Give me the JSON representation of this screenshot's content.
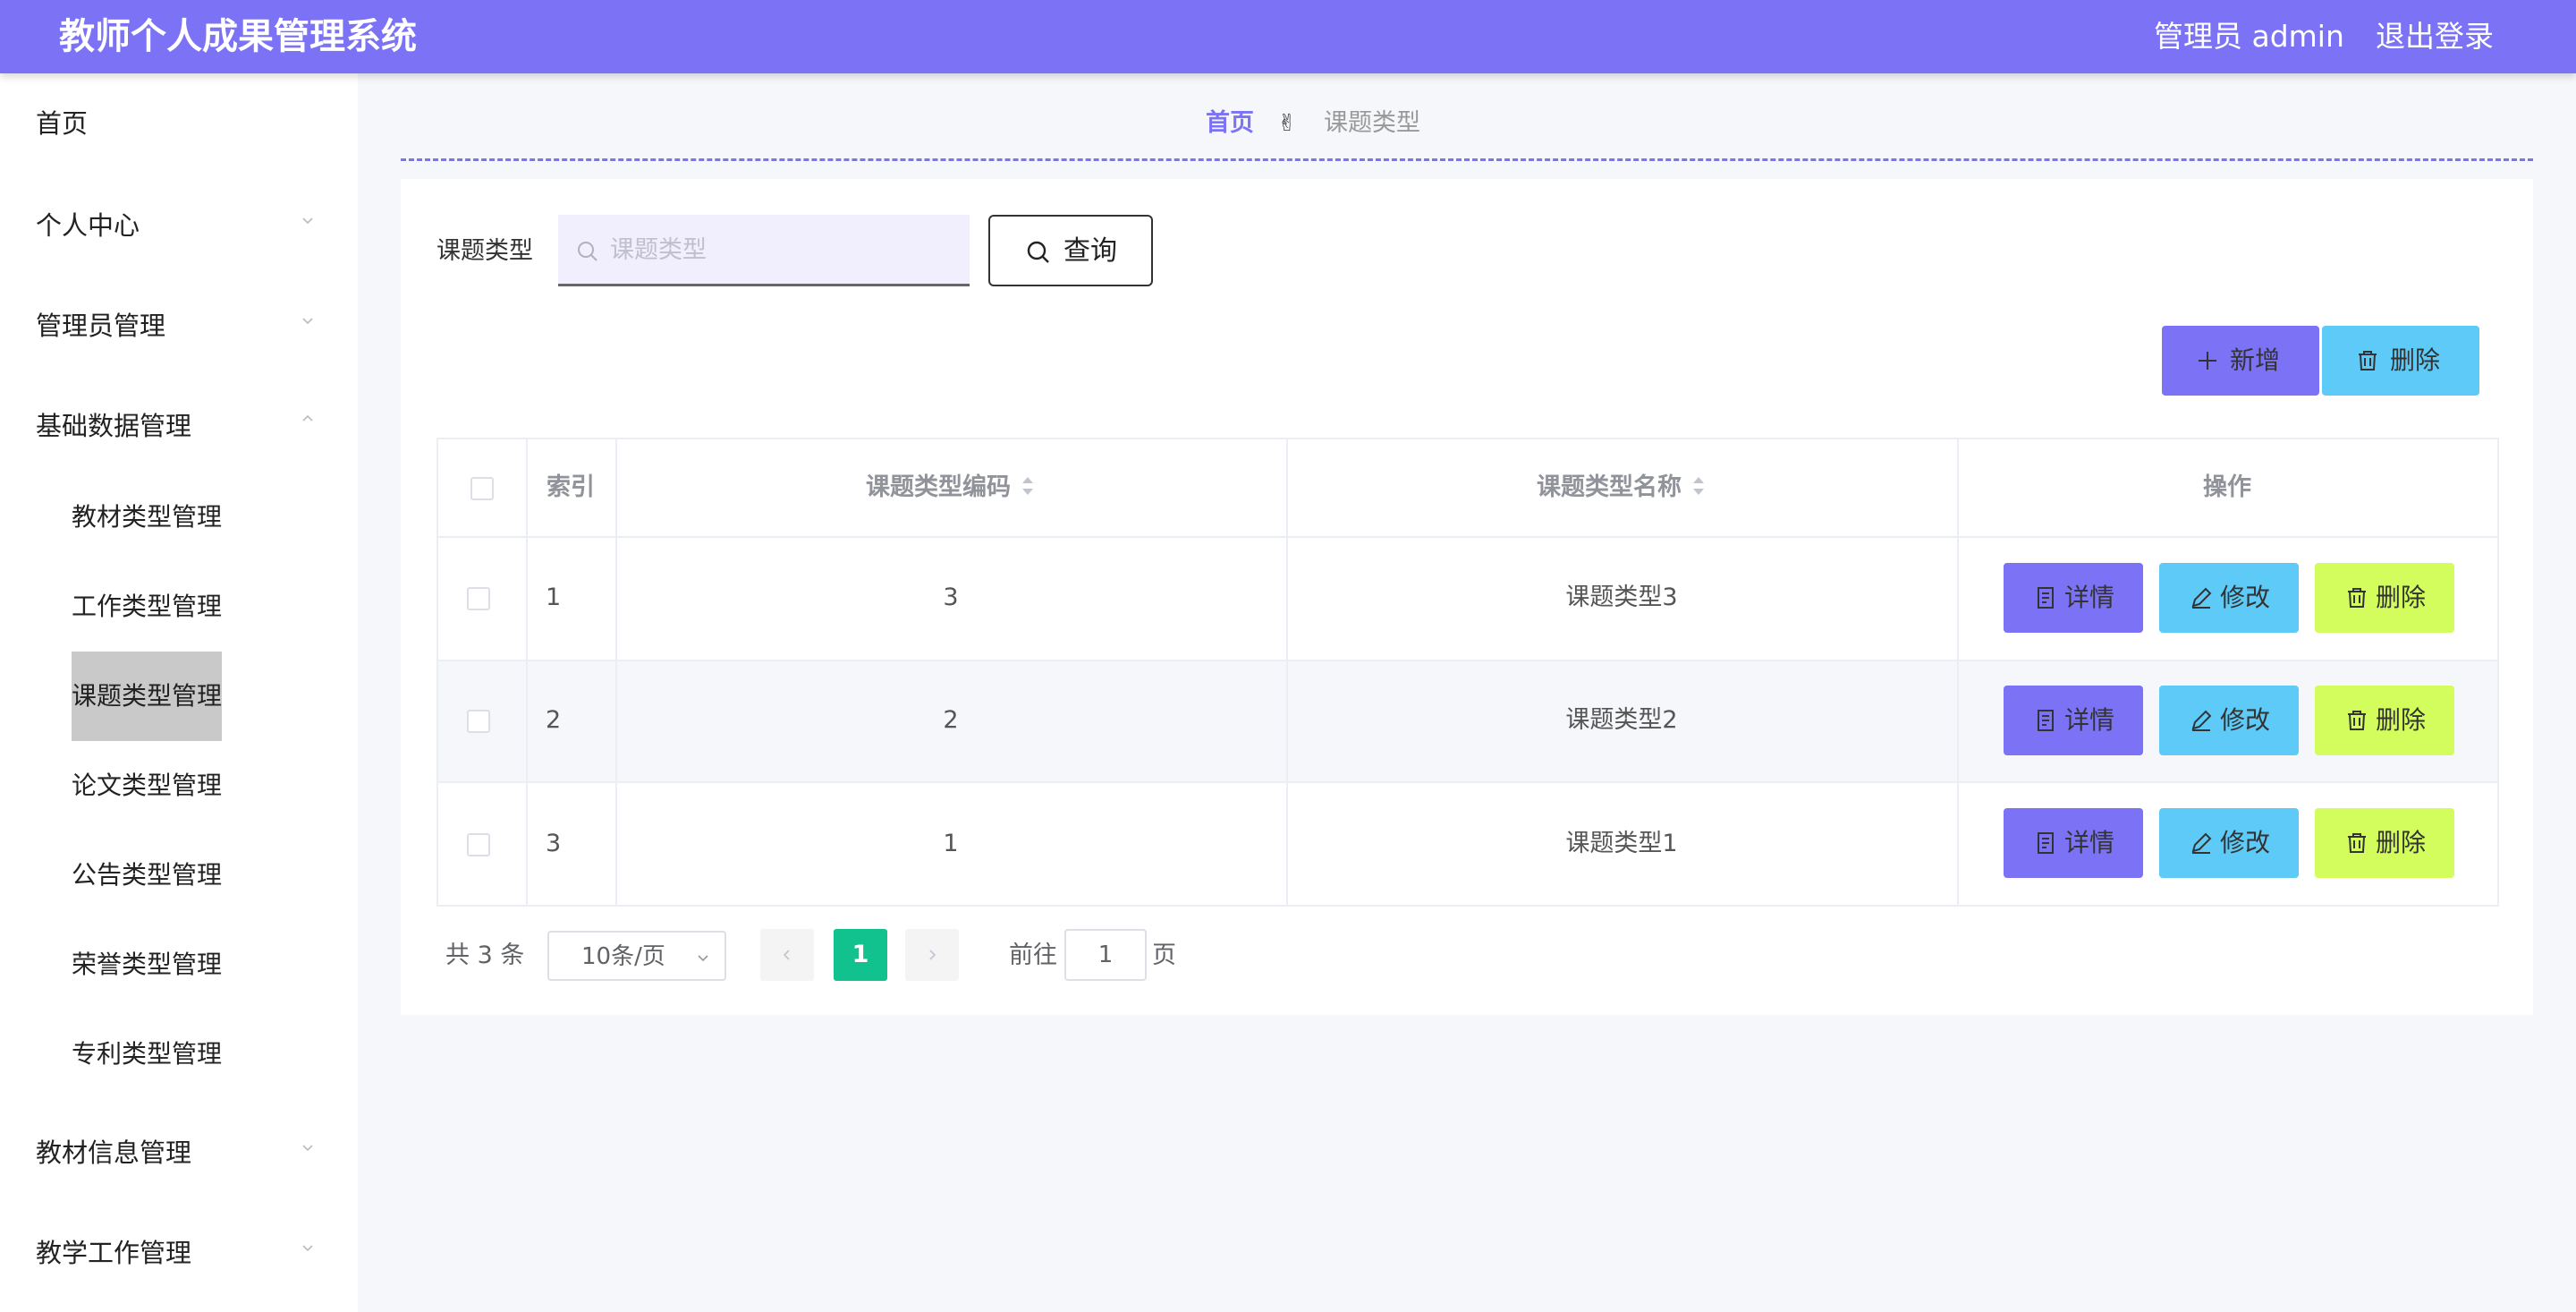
{
  "header": {
    "title": "教师个人成果管理系统",
    "user": "管理员 admin",
    "logout": "退出登录"
  },
  "sidebar": {
    "items": [
      {
        "label": "首页"
      },
      {
        "label": "个人中心"
      },
      {
        "label": "管理员管理"
      },
      {
        "label": "基础数据管理"
      },
      {
        "label": "教材信息管理"
      },
      {
        "label": "教学工作管理"
      }
    ],
    "subitems": [
      {
        "label": "教材类型管理"
      },
      {
        "label": "工作类型管理"
      },
      {
        "label": "课题类型管理",
        "active": true
      },
      {
        "label": "论文类型管理"
      },
      {
        "label": "公告类型管理"
      },
      {
        "label": "荣誉类型管理"
      },
      {
        "label": "专利类型管理"
      }
    ]
  },
  "breadcrumb": {
    "home": "首页",
    "separator": "✌",
    "current": "课题类型"
  },
  "search": {
    "label": "课题类型",
    "placeholder": "课题类型",
    "value": "",
    "query_button": "查询"
  },
  "toolbar": {
    "add": "新增",
    "delete": "删除"
  },
  "table": {
    "headers": [
      "索引",
      "课题类型编码",
      "课题类型名称",
      "操作"
    ],
    "rows": [
      {
        "index": "1",
        "code": "3",
        "name": "课题类型3"
      },
      {
        "index": "2",
        "code": "2",
        "name": "课题类型2"
      },
      {
        "index": "3",
        "code": "1",
        "name": "课题类型1"
      }
    ],
    "actions": {
      "detail": "详情",
      "edit": "修改",
      "delete": "删除"
    }
  },
  "pagination": {
    "total": "共 3 条",
    "page_size": "10条/页",
    "current_page": "1",
    "goto_label": "前往",
    "goto_value": "1",
    "goto_unit": "页"
  },
  "colors": {
    "primary": "#7b72f5",
    "info": "#5ecaf7",
    "danger_action": "#d2fd5d",
    "pager_active": "#11c28e"
  }
}
